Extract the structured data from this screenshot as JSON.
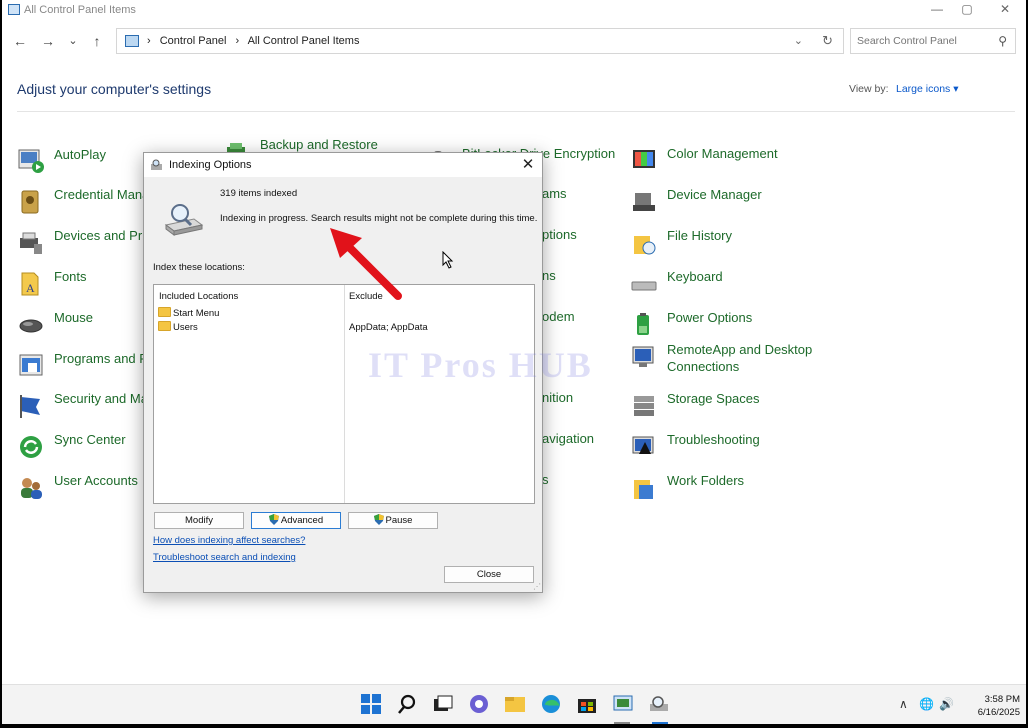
{
  "window": {
    "title": "All Control Panel Items",
    "controls": [
      "—",
      "▢",
      "✕"
    ]
  },
  "nav": {
    "back": "←",
    "forward": "→",
    "recent": "⌄",
    "up": "↑"
  },
  "address": {
    "crumbs": [
      "›",
      "Control Panel",
      "›",
      "All Control Panel Items"
    ],
    "dropdown": "⌄",
    "refresh": "↻"
  },
  "search": {
    "placeholder": "Search Control Panel",
    "icon": "⚲"
  },
  "header": {
    "title": "Adjust your computer's settings",
    "view_by_label": "View by:",
    "view_by_value": "Large icons ▾"
  },
  "items": [
    {
      "label": "AutoPlay",
      "icon": "autoplay-icon"
    },
    {
      "label": "Backup and Restore",
      "icon": "backup-icon"
    },
    {
      "label": "BitLocker Drive Encryption",
      "icon": "bitlocker-icon"
    },
    {
      "label": "Color Management",
      "icon": "color-icon"
    },
    {
      "label": "Credential Mana",
      "icon": "credential-icon"
    },
    {
      "label": "ams",
      "icon": "default-programs-icon"
    },
    {
      "label": "Device Manager",
      "icon": "device-manager-icon"
    },
    {
      "label": "Devices and Prin",
      "icon": "devices-icon"
    },
    {
      "label": "ptions",
      "icon": "options-icon"
    },
    {
      "label": "File History",
      "icon": "file-history-icon"
    },
    {
      "label": "Fonts",
      "icon": "fonts-icon"
    },
    {
      "label": "ns",
      "icon": "ns-icon"
    },
    {
      "label": "Keyboard",
      "icon": "keyboard-icon"
    },
    {
      "label": "Mouse",
      "icon": "mouse-icon"
    },
    {
      "label": "odem",
      "icon": "modem-icon"
    },
    {
      "label": "Power Options",
      "icon": "power-icon"
    },
    {
      "label": "Programs and F",
      "icon": "programs-icon"
    },
    {
      "label": "RemoteApp and Desktop Connections",
      "icon": "remoteapp-icon"
    },
    {
      "label": "Security and Ma",
      "icon": "security-icon"
    },
    {
      "label": "nition",
      "icon": "speech-icon"
    },
    {
      "label": "Storage Spaces",
      "icon": "storage-icon"
    },
    {
      "label": "Sync Center",
      "icon": "sync-icon"
    },
    {
      "label": "avigation",
      "icon": "navigation-icon"
    },
    {
      "label": "Troubleshooting",
      "icon": "troubleshooting-icon"
    },
    {
      "label": "User Accounts",
      "icon": "user-accounts-icon"
    },
    {
      "label": "s",
      "icon": "s-icon"
    },
    {
      "label": "Work Folders",
      "icon": "work-folders-icon"
    }
  ],
  "watermark": "IT Pros HUB",
  "dialog": {
    "title": "Indexing Options",
    "close_icon": "✕",
    "count": "319 items indexed",
    "status": "Indexing in progress. Search results might not be complete during this time.",
    "locations_label": "Index these locations:",
    "columns": [
      "Included Locations",
      "Exclude"
    ],
    "rows": [
      {
        "location": "Start Menu",
        "exclude": ""
      },
      {
        "location": "Users",
        "exclude": "AppData; AppData"
      }
    ],
    "buttons": {
      "modify": "Modify",
      "advanced": "Advanced",
      "pause": "Pause",
      "close": "Close"
    },
    "links": {
      "how": "How does indexing affect searches?",
      "troubleshoot": "Troubleshoot search and indexing"
    }
  },
  "taskbar": {
    "apps": [
      "start-icon",
      "search-icon",
      "task-view-icon",
      "chat-icon",
      "file-explorer-icon",
      "edge-icon",
      "store-icon",
      "control-panel-icon",
      "indexing-options-icon"
    ],
    "tray": {
      "chevron": "∧",
      "network": "🌐",
      "volume": "🔊"
    },
    "time": "3:58 PM",
    "date": "6/16/2025"
  },
  "colors": {
    "link_green": "#1d6a2a",
    "heading_blue": "#1e3a6e",
    "accent_blue": "#0a58ca",
    "arrow_red": "#e1121a"
  }
}
